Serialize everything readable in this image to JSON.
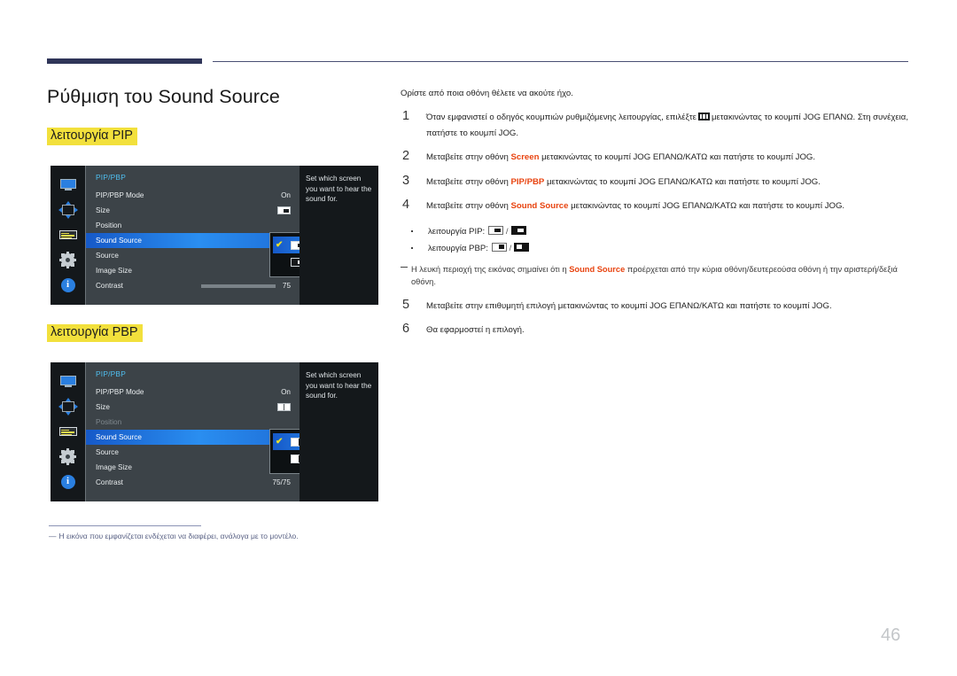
{
  "document": {
    "page_number": "46",
    "title": "Ρύθμιση του Sound Source",
    "section_pip": "λειτουργία PIP",
    "section_pbp": "λειτουργία PBP",
    "footnote_dash": "―",
    "footnote": "Η εικόνα που εμφανίζεται ενδέχεται να διαφέρει, ανάλογα με το μοντέλο."
  },
  "osd_pip": {
    "title": "PIP/PBP",
    "rows": [
      {
        "label": "PIP/PBP Mode",
        "value": "On"
      },
      {
        "label": "Size",
        "value": ""
      },
      {
        "label": "Position",
        "value": ""
      },
      {
        "label": "Sound Source",
        "value": ""
      },
      {
        "label": "Source",
        "value": ""
      },
      {
        "label": "Image Size",
        "value": ""
      },
      {
        "label": "Contrast",
        "value": "75"
      }
    ],
    "help_text": "Set which screen you want to hear the sound for.",
    "dropdown": {
      "item_main": "pip-main-screen-option",
      "item_sub": "pip-sub-screen-option",
      "check": "✔"
    },
    "icons": {
      "rail": [
        "monitor-icon",
        "move-arrows-icon",
        "list-lines-icon",
        "gear-icon",
        "info-icon"
      ],
      "size_glyph": "pip-size-glyph"
    }
  },
  "osd_pbp": {
    "title": "PIP/PBP",
    "rows": [
      {
        "label": "PIP/PBP Mode",
        "value": "On"
      },
      {
        "label": "Size",
        "value": ""
      },
      {
        "label": "Position",
        "value": ""
      },
      {
        "label": "Sound Source",
        "value": ""
      },
      {
        "label": "Source",
        "value": ""
      },
      {
        "label": "Image Size",
        "value": ""
      },
      {
        "label": "Contrast",
        "value": "75/75"
      }
    ],
    "help_text": "Set which screen you want to hear the sound for.",
    "dropdown": {
      "item_left": "pbp-left-screen-option",
      "item_right": "pbp-right-screen-option",
      "check": "✔"
    },
    "icons": {
      "rail": [
        "monitor-icon",
        "move-arrows-icon",
        "list-lines-icon",
        "gear-icon",
        "info-icon"
      ],
      "size_glyph": "pbp-size-glyph"
    }
  },
  "instructions": {
    "intro": "Ορίστε από ποια οθόνη θέλετε να ακούτε ήχο.",
    "steps": [
      {
        "num": "1",
        "text_a": "Όταν εμφανιστεί ο οδηγός κουμπιών ρυθμιζόμενης λειτουργίας, επιλέξτε",
        "icon": "jog-guide-icon",
        "text_b": "μετακινώντας το κουμπί JOG ΕΠΑΝΩ. Στη συνέχεια, πατήστε το κουμπί JOG."
      },
      {
        "num": "2",
        "text_a": "Μεταβείτε στην οθόνη",
        "highlight": "Screen",
        "text_b": "μετακινώντας το κουμπί JOG ΕΠΑΝΩ/ΚΑΤΩ και πατήστε το κουμπί JOG."
      },
      {
        "num": "3",
        "text_a": "Μεταβείτε στην οθόνη",
        "highlight": "PIP/PBP",
        "text_b": "μετακινώντας το κουμπί JOG ΕΠΑΝΩ/ΚΑΤΩ και πατήστε το κουμπί JOG."
      },
      {
        "num": "4",
        "text_a": "Μεταβείτε στην οθόνη",
        "highlight": "Sound Source",
        "text_b": "μετακινώντας το κουμπί JOG ΕΠΑΝΩ/ΚΑΤΩ και πατήστε το κουμπί JOG."
      },
      {
        "num": "5",
        "text_a": "Μεταβείτε στην επιθυμητή επιλογή μετακινώντας το κουμπί JOG ΕΠΑΝΩ/ΚΑΤΩ και πατήστε το κουμπί JOG.",
        "highlight": "",
        "text_b": ""
      },
      {
        "num": "6",
        "text_a": "Θα εφαρμοστεί η επιλογή.",
        "highlight": "",
        "text_b": ""
      }
    ],
    "bullets": [
      {
        "label": "λειτουργία PIP:",
        "sep": "/"
      },
      {
        "label": "λειτουργία PBP:",
        "sep": "/"
      }
    ],
    "note": {
      "text_a": "Η λευκή περιοχή της εικόνας σημαίνει ότι η",
      "highlight": "Sound Source",
      "text_b": "προέρχεται από την κύρια οθόνη/δευτερεούσα οθόνη ή την αριστερή/δεξιά οθόνη."
    }
  },
  "colors": {
    "accent_red": "#e8430f",
    "highlight_yellow": "#f2e03c",
    "header_navy": "#2f3558",
    "osd_blue": "#2a8ef0",
    "osd_title_cyan": "#4fbff0"
  }
}
